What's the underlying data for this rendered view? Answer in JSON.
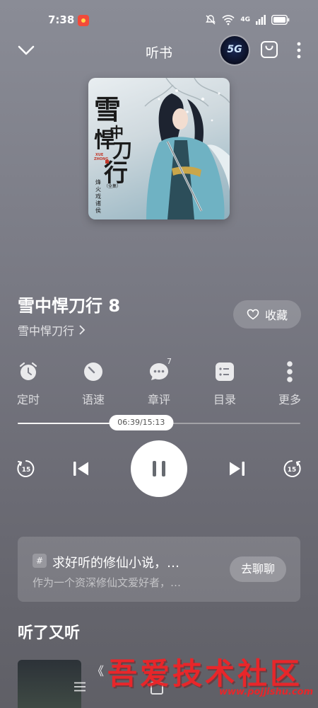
{
  "status_bar": {
    "time": "7:38",
    "network_label": "4G",
    "app_badge_color": "#f24a3a",
    "icons": [
      "mute-icon",
      "wifi-icon",
      "signal-icon",
      "battery-icon"
    ]
  },
  "header": {
    "title": "听书",
    "fiveg_label": "5G",
    "icons": [
      "chevron-down-icon",
      "bag-icon",
      "more-vertical-icon"
    ]
  },
  "cover": {
    "title_text": "雪中悍刀行",
    "pinyin_text": "XUE ZHONG",
    "author_text": "烽火戏诸侯",
    "volume_text": "（全集）"
  },
  "track": {
    "title": "雪中悍刀行 8",
    "album": "雪中悍刀行",
    "favorite_label": "收藏"
  },
  "tools": [
    {
      "label": "定时",
      "icon": "alarm-clock-icon"
    },
    {
      "label": "语速",
      "icon": "speed-dial-icon"
    },
    {
      "label": "章评",
      "icon": "comment-icon",
      "badge": "7"
    },
    {
      "label": "目录",
      "icon": "catalog-icon"
    },
    {
      "label": "更多",
      "icon": "more-vertical-icon"
    }
  ],
  "progress": {
    "label": "06:39/15:13",
    "fraction": 0.437
  },
  "controls": {
    "rewind_label": "15",
    "forward_label": "15",
    "icons": [
      "rewind-15-icon",
      "previous-icon",
      "pause-icon",
      "next-icon",
      "forward-15-icon"
    ]
  },
  "chat_card": {
    "hash": "#",
    "title": "求好听的修仙小说，…",
    "subtitle": "作为一个资深修仙文爱好者，…",
    "button_label": "去聊聊"
  },
  "section": {
    "title": "听了又听",
    "first_item_text": "《"
  },
  "watermark": {
    "main": "吾爱技术社区",
    "url": "www.pojjishu.com",
    "color": "#e8262a"
  },
  "accent_colors": {
    "background_top": "#8a8c96",
    "background_bottom": "#5f5f66",
    "play_button": "#ffffff"
  }
}
